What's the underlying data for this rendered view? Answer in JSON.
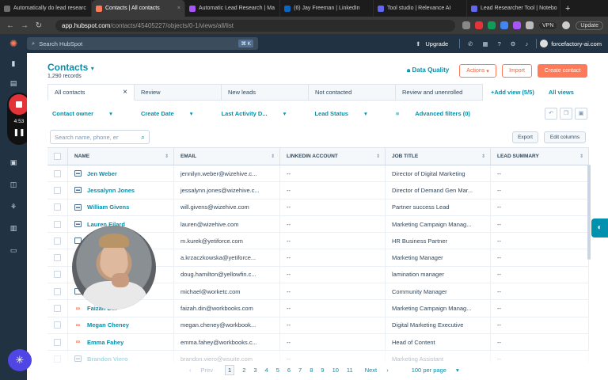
{
  "browser": {
    "tabs": [
      {
        "title": "Automatically do lead researc",
        "color": "#6d6d6d",
        "active": false
      },
      {
        "title": "Contacts | All contacts",
        "color": "#ff7a59",
        "active": true
      },
      {
        "title": "Automatic Lead Research | Ma",
        "color": "#a855f7",
        "active": false
      },
      {
        "title": "(6) Jay Freeman | LinkedIn",
        "color": "#0a66c2",
        "active": false
      },
      {
        "title": "Tool studio | Relevance AI",
        "color": "#6366f1",
        "active": false
      },
      {
        "title": "Lead Researcher Tool | Notebo",
        "color": "#6366f1",
        "active": false
      }
    ],
    "url_host": "app.hubspot.com",
    "url_path": "/contacts/45405227/objects/0-1/views/all/list",
    "vpn_label": "VPN",
    "update_label": "Update"
  },
  "hubspot_nav": {
    "search_placeholder": "Search HubSpot",
    "search_kbd": "⌘ K",
    "upgrade_label": "Upgrade",
    "account_label": "forcefactory-ai.com"
  },
  "recorder": {
    "time": "4:53"
  },
  "header": {
    "title": "Contacts",
    "records": "1,290 records",
    "data_quality": "Data Quality",
    "actions": "Actions",
    "import": "Import",
    "create": "Create contact"
  },
  "views": {
    "tabs": [
      "All contacts",
      "Review",
      "New leads",
      "Not contacted",
      "Review and unenrolled"
    ],
    "add_view": "Add view (5/5)",
    "all_views": "All views"
  },
  "filters": {
    "items": [
      "Contact owner",
      "Create Date",
      "Last Activity D...",
      "Lead Status",
      "Advanced filters (0)"
    ]
  },
  "table_controls": {
    "search_placeholder": "Search name, phone, er",
    "export": "Export",
    "edit_columns": "Edit columns"
  },
  "table": {
    "columns": [
      "NAME",
      "EMAIL",
      "LINKEDIN ACCOUNT",
      "JOB TITLE",
      "LEAD SUMMARY"
    ],
    "rows": [
      {
        "name": "Jen Weber",
        "email": "jennilyn.weber@wizehive.c...",
        "linkedin": "--",
        "job": "Director of Digital Marketing",
        "summary": "--",
        "icon": "form"
      },
      {
        "name": "Jessalynn Jones",
        "email": "jessalynn.jones@wizehive.c...",
        "linkedin": "--",
        "job": "Director of Demand Gen Mar...",
        "summary": "--",
        "icon": "form"
      },
      {
        "name": "William Givens",
        "email": "will.givens@wizehive.com",
        "linkedin": "--",
        "job": "Partner success Lead",
        "summary": "--",
        "icon": "form"
      },
      {
        "name": "Lauren Eilard",
        "email": "lauren@wizehive.com",
        "linkedin": "--",
        "job": "Marketing Campaign Manag...",
        "summary": "--",
        "icon": "form"
      },
      {
        "name": "",
        "email": "m.kurek@yetiforce.com",
        "linkedin": "--",
        "job": "HR Business Partner",
        "summary": "--",
        "icon": "none"
      },
      {
        "name": "",
        "email": "a.krzaczkowska@yetiforce...",
        "linkedin": "--",
        "job": "Marketing Manager",
        "summary": "--",
        "icon": "none"
      },
      {
        "name": "",
        "email": "doug.hamilton@yellowfin.c...",
        "linkedin": "--",
        "job": "lamination manager",
        "summary": "--",
        "icon": "none"
      },
      {
        "name": "",
        "email": "michael@worketc.com",
        "linkedin": "--",
        "job": "Community Manager",
        "summary": "--",
        "icon": "none"
      },
      {
        "name": "Faizah Din",
        "email": "faizah.din@workbooks.com",
        "linkedin": "--",
        "job": "Marketing Campaign Manag...",
        "summary": "--",
        "icon": "link"
      },
      {
        "name": "Megan Cheney",
        "email": "megan.cheney@workbook...",
        "linkedin": "--",
        "job": "Digital Marketing Executive",
        "summary": "--",
        "icon": "link"
      },
      {
        "name": "Emma Fahey",
        "email": "emma.fahey@workbooks.c...",
        "linkedin": "--",
        "job": "Head of Content",
        "summary": "--",
        "icon": "link"
      },
      {
        "name": "Brandon Viero",
        "email": "brandon.viero@wsuite.com",
        "linkedin": "--",
        "job": "Marketing Assistant",
        "summary": "--",
        "icon": "form"
      }
    ]
  },
  "pagination": {
    "prev": "Prev",
    "pages": [
      "1",
      "2",
      "3",
      "4",
      "5",
      "6",
      "7",
      "8",
      "9",
      "10",
      "11"
    ],
    "current": "1",
    "next": "Next",
    "per_page": "100 per page"
  }
}
